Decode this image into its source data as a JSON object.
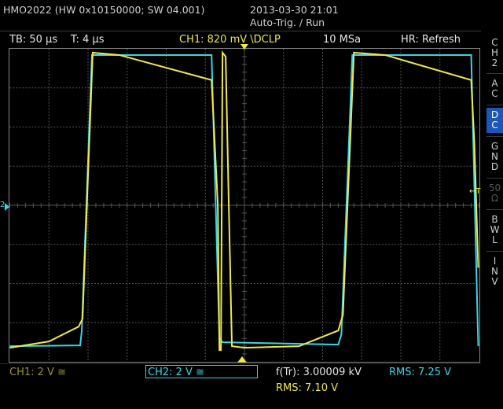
{
  "header": {
    "device": "HMO2022 (HW 0x10150000; SW 04.001)",
    "datetime": "2013-03-30 21:01",
    "status": "Auto-Trig. / Run"
  },
  "settings_bar": {
    "timebase": "TB: 50 µs",
    "trigger_time": "T: 4 µs",
    "ch1_trigger": "CH1: 820 mV \\DCLP",
    "sample_rate": "10 MSa",
    "hr_mode": "HR: Refresh"
  },
  "side_menu": {
    "channel": [
      "C",
      "H",
      "2"
    ],
    "items": [
      {
        "label": [
          "A",
          "C"
        ],
        "selected": false,
        "disabled": false
      },
      {
        "label": [
          "D",
          "C"
        ],
        "selected": true,
        "disabled": false
      },
      {
        "label": [
          "G",
          "N",
          "D"
        ],
        "selected": false,
        "disabled": false
      },
      {
        "label": [
          "50",
          "Ω"
        ],
        "selected": false,
        "disabled": true
      },
      {
        "label": [
          "B",
          "W",
          "L"
        ],
        "selected": false,
        "disabled": false
      },
      {
        "label": [
          "I",
          "N",
          "V"
        ],
        "selected": false,
        "disabled": false
      }
    ]
  },
  "markers": {
    "ch2_level": "2",
    "trigger_level": "T"
  },
  "footer": {
    "ch1_scale": "CH1: 2 V ≅",
    "ch2_scale": "CH2: 2 V ≅",
    "frequency": "f(Tr): 3.00009 kV",
    "rms_ch2": "RMS: 7.25 V",
    "rms_ch1": "RMS: 7.10 V"
  },
  "colors": {
    "ch1": "#f2e84a",
    "ch2": "#38d6e6",
    "grid": "#555555",
    "selected": "#1c56b8"
  }
}
